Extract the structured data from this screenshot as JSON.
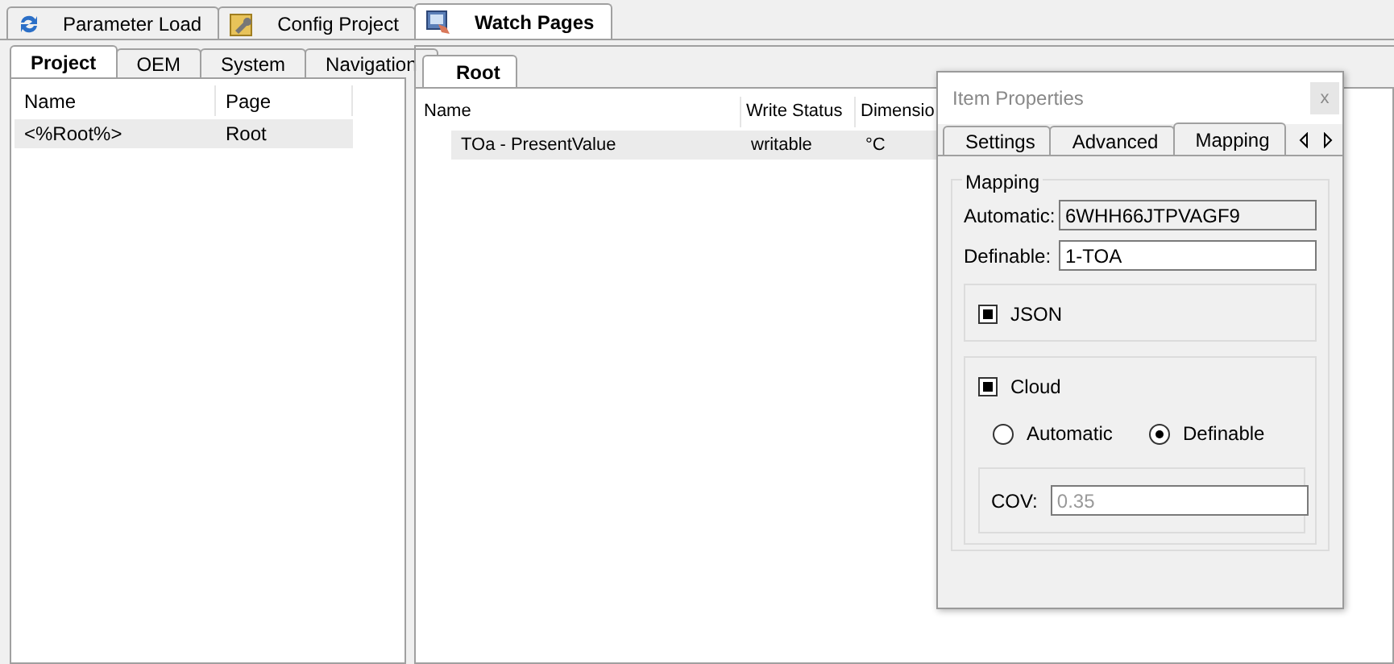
{
  "main_tabs": [
    {
      "label": "Parameter Load",
      "selected": false
    },
    {
      "label": "Config Project",
      "selected": false
    },
    {
      "label": "Watch Pages",
      "selected": true
    }
  ],
  "sub_tabs": [
    {
      "label": "Project",
      "selected": true
    },
    {
      "label": "OEM",
      "selected": false
    },
    {
      "label": "System",
      "selected": false
    },
    {
      "label": "Navigation",
      "selected": false
    }
  ],
  "project_list": {
    "columns": [
      "Name",
      "Page"
    ],
    "rows": [
      {
        "cells": [
          "<%Root%>",
          "Root"
        ],
        "selected": true
      }
    ]
  },
  "page_tabs": [
    {
      "label": "Root",
      "selected": true
    }
  ],
  "watch_table": {
    "columns": [
      "Name",
      "Write Status",
      "Dimensio"
    ],
    "rows": [
      {
        "cells": [
          "TOa - PresentValue",
          "writable",
          "°C"
        ],
        "selected": true
      }
    ]
  },
  "dialog": {
    "title": "Item Properties",
    "close": "x",
    "tabs": [
      {
        "label": "Settings",
        "selected": false
      },
      {
        "label": "Advanced",
        "selected": false
      },
      {
        "label": "Mapping",
        "selected": true
      }
    ],
    "group_title": "Mapping",
    "fields": [
      {
        "label": "Automatic:",
        "value": "6WHH66JTPVAGF9",
        "disabled": true
      },
      {
        "label": "Definable:",
        "value": "1-TOA",
        "disabled": false
      }
    ],
    "json": {
      "label": "JSON",
      "checked": true
    },
    "cloud": {
      "label": "Cloud",
      "checked": true
    },
    "radios": [
      {
        "label": "Automatic",
        "selected": false
      },
      {
        "label": "Definable",
        "selected": true
      }
    ],
    "cov": {
      "label": "COV:",
      "value": "0.35",
      "disabled": true
    }
  }
}
